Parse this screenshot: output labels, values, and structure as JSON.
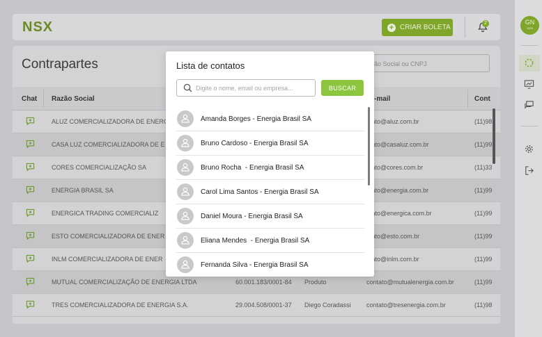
{
  "topbar": {
    "logo": "NSX",
    "criar_boleta": "CRIAR BOLETA",
    "notification_count": "2"
  },
  "user": {
    "initials": "GN",
    "code": "1029"
  },
  "page": {
    "title": "Contrapartes",
    "search_placeholder": "ão Social ou CNPJ"
  },
  "table": {
    "headers": {
      "chat": "Chat",
      "razao": "Razão Social",
      "email": "-mail",
      "cont": "Cont"
    },
    "rows": [
      {
        "razao": "ALUZ COMERCIALIZADORA DE ENERG",
        "cnpj": "",
        "contato": "",
        "email": "ntato@aluz.com.br",
        "tel": "(11)98"
      },
      {
        "razao": "CASA LUZ COMERCIALIZADORA DE E",
        "cnpj": "",
        "contato": "",
        "email": "ntato@casaluz.com.br",
        "tel": "(11)99"
      },
      {
        "razao": "CORES COMERCIALIZAÇÃO SA",
        "cnpj": "",
        "contato": "",
        "email": "ntato@cores.com.br",
        "tel": "(11)33"
      },
      {
        "razao": "ENERGIA BRASIL SA",
        "cnpj": "",
        "contato": "",
        "email": "ntato@energia.com.br",
        "tel": "(11)99"
      },
      {
        "razao": "ENERGICA  TRADING COMERCIALIZ",
        "cnpj": "",
        "contato": "",
        "email": "ntato@energica.com.br",
        "tel": "(11)99"
      },
      {
        "razao": "ESTO COMERCIALIZADORA DE ENER",
        "cnpj": "",
        "contato": "",
        "email": "ntato@esto.com.br",
        "tel": "(11)99"
      },
      {
        "razao": "INLM COMERCIALIZADORA DE ENER",
        "cnpj": "",
        "contato": "",
        "email": "ntato@inlm.com.br",
        "tel": "(11)99"
      },
      {
        "razao": "MUTUAL COMERCIALIZAÇÃO DE ENERGIA LTDA",
        "cnpj": "60.001.183/0001-84",
        "contato": "Produto",
        "email": "contato@mutualenergia.com.br",
        "tel": "(11)99"
      },
      {
        "razao": "TRES COMERCIALIZADORA DE ENERGIA S.A.",
        "cnpj": "29.004.508/0001-37",
        "contato": "Diego Coradassi",
        "email": "contato@tresenergia.com.br",
        "tel": "(11)98"
      }
    ]
  },
  "modal": {
    "title": "Lista de contatos",
    "search_placeholder": "Digite o nome, email ou empresa...",
    "buscar": "BUSCAR",
    "contacts": [
      "Amanda Borges - Energia Brasil SA",
      "Bruno Cardoso - Energia Brasil SA",
      "Bruno Rocha  - Energia Brasil SA",
      "Carol Lima Santos - Energia Brasil SA",
      "Daniel Moura - Energia Brasil SA",
      "Eliana Mendes  - Energia Brasil SA",
      "Fernanda Silva - Energia Brasil SA"
    ]
  },
  "colors": {
    "brand": "#8cc63f",
    "brand_dim": "#7fa52b"
  }
}
